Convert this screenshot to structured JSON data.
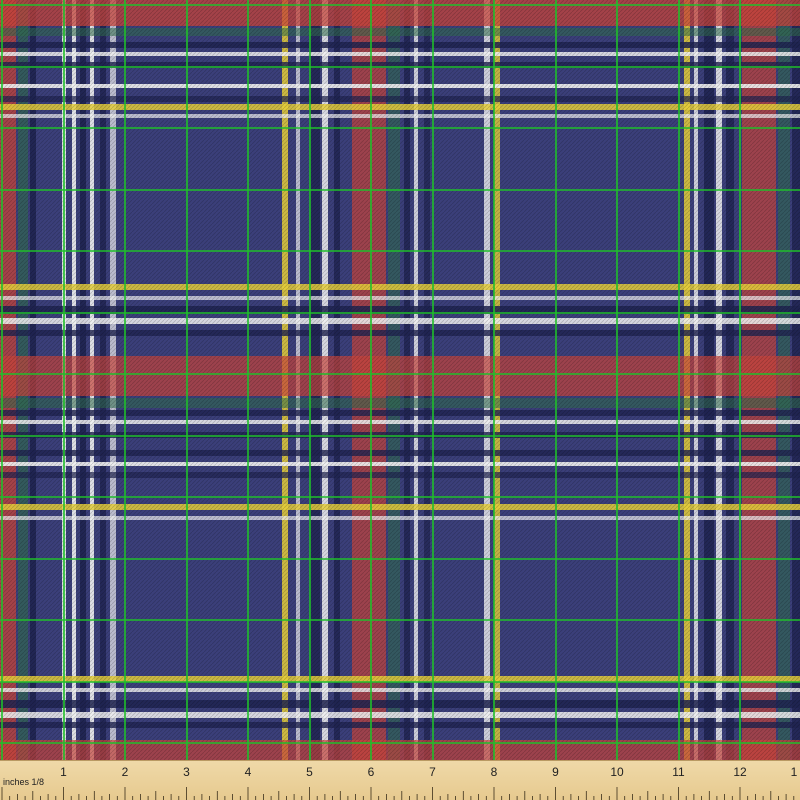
{
  "image": {
    "subject": "tartan-plaid-fabric-swatch",
    "colors": {
      "ground": "#3b3f7a",
      "red": "#c8443a",
      "yellow": "#e6cf3a",
      "white": "#f2f2f2",
      "green": "#2f6d4a",
      "navy": "#1f2350",
      "grid_line": "#1fbf2a"
    }
  },
  "ruler": {
    "unit_label": "inches 1/8",
    "numbers": [
      "1",
      "2",
      "3",
      "4",
      "5",
      "6",
      "7",
      "8",
      "9",
      "10",
      "11",
      "12",
      "1"
    ]
  }
}
